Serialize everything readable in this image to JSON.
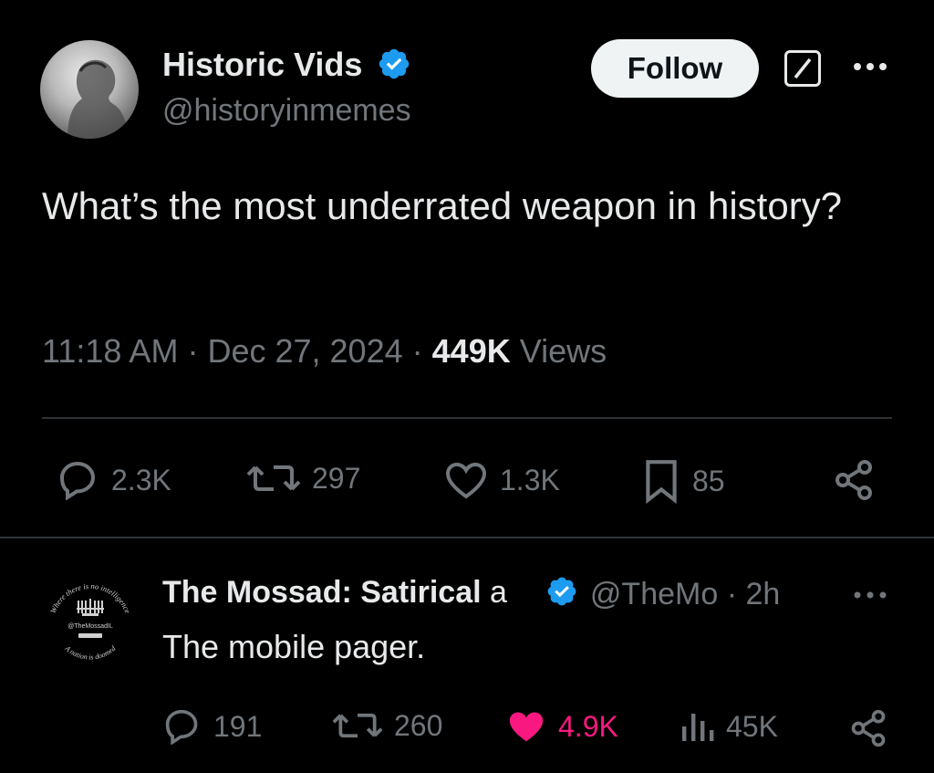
{
  "tweet": {
    "author_name": "Historic Vids",
    "author_handle": "@historyinmemes",
    "follow_label": "Follow",
    "text": "What’s the most underrated weapon in history?",
    "time": "11:18 AM",
    "date": "Dec 27, 2024",
    "views_count": "449K",
    "views_label": "Views",
    "separator": "·",
    "actions": {
      "replies": "2.3K",
      "reposts": "297",
      "likes": "1.3K",
      "bookmarks": "85"
    }
  },
  "reply": {
    "author_name": "The Mossad: Satirical",
    "author_name_cut": "a",
    "handle": "@TheMo",
    "separator": "·",
    "age": "2h",
    "text": "The mobile pager.",
    "actions": {
      "replies": "191",
      "reposts": "260",
      "likes": "4.9K",
      "views": "45K"
    },
    "avatar_text": {
      "top": "Where there is no intelligence",
      "middle": "@TheMossadIL",
      "bottom": "A nation is doomed"
    }
  },
  "colors": {
    "verified": "#1d9bf0",
    "like": "#f91880",
    "muted": "#71767b",
    "text": "#e7e9ea"
  }
}
